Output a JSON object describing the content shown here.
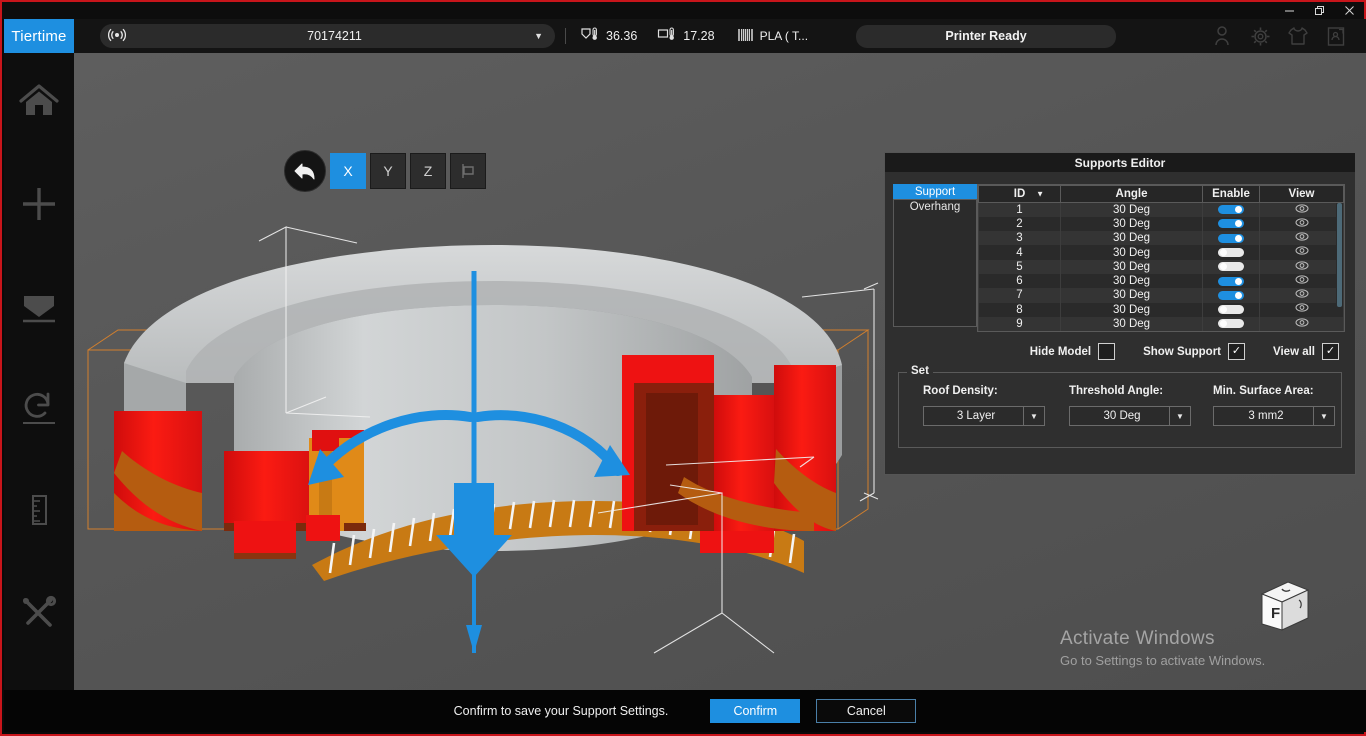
{
  "window": {
    "minimize_label": "minimize",
    "restore_label": "restore",
    "close_label": "close"
  },
  "toolbar": {
    "brand": "Tiertime",
    "printer_id": "70174211",
    "wifi_icon": "wifi-icon",
    "dropdown_icon": "chevron-down-icon",
    "nozzle_icon": "nozzle-temperature-icon",
    "nozzle_temp": "36.36",
    "bed_icon": "bed-temperature-icon",
    "bed_temp": "17.28",
    "material_icon": "material-spool-icon",
    "material": "PLA ( T...",
    "status": "Printer Ready",
    "right_icons": [
      {
        "name": "user-account-icon",
        "glyph": "user"
      },
      {
        "name": "settings-gear-icon",
        "glyph": "gear"
      },
      {
        "name": "theme-shirt-icon",
        "glyph": "shirt"
      },
      {
        "name": "export-print-icon",
        "glyph": "export"
      }
    ]
  },
  "sidebar": {
    "items": [
      {
        "name": "sidebar-item-home",
        "icon": "home-icon",
        "label": "Home"
      },
      {
        "name": "sidebar-item-add",
        "icon": "plus-icon",
        "label": "Add"
      },
      {
        "name": "sidebar-item-placement",
        "icon": "placement-icon",
        "label": "Placement"
      },
      {
        "name": "sidebar-item-rotate",
        "icon": "rotate-icon",
        "label": "Rotate"
      },
      {
        "name": "sidebar-item-scale",
        "icon": "ruler-icon",
        "label": "Scale"
      },
      {
        "name": "sidebar-item-tools",
        "icon": "tools-icon",
        "label": "Tools"
      }
    ]
  },
  "viewport": {
    "axis_toolbar": {
      "undo_icon": "undo-arrow-icon",
      "buttons": [
        {
          "label": "X",
          "active": true,
          "name": "axis-x-button"
        },
        {
          "label": "Y",
          "active": false,
          "name": "axis-y-button"
        },
        {
          "label": "Z",
          "active": false,
          "name": "axis-z-button"
        },
        {
          "label": "",
          "active": false,
          "name": "axis-mirror-button"
        }
      ]
    },
    "view_cube_face": "F",
    "watermark_title": "Activate Windows",
    "watermark_subtitle": "Go to Settings to activate Windows."
  },
  "panel": {
    "title": "Supports Editor",
    "tabs": [
      {
        "label": "Support",
        "active": true
      },
      {
        "label": "Overhang",
        "active": false
      }
    ],
    "table": {
      "columns": [
        "ID",
        "Angle",
        "Enable",
        "View"
      ],
      "sort_icon": "sort-descending-icon",
      "eye_icon": "eye-icon",
      "rows": [
        {
          "id": "1",
          "angle": "30 Deg",
          "enabled": true
        },
        {
          "id": "2",
          "angle": "30 Deg",
          "enabled": true
        },
        {
          "id": "3",
          "angle": "30 Deg",
          "enabled": true
        },
        {
          "id": "4",
          "angle": "30 Deg",
          "enabled": false
        },
        {
          "id": "5",
          "angle": "30 Deg",
          "enabled": false
        },
        {
          "id": "6",
          "angle": "30 Deg",
          "enabled": true
        },
        {
          "id": "7",
          "angle": "30 Deg",
          "enabled": true
        },
        {
          "id": "8",
          "angle": "30 Deg",
          "enabled": false
        },
        {
          "id": "9",
          "angle": "30 Deg",
          "enabled": false
        }
      ]
    },
    "checkboxes": [
      {
        "label": "Hide Model",
        "checked": false,
        "name": "hide-model-checkbox"
      },
      {
        "label": "Show Support",
        "checked": true,
        "name": "show-support-checkbox"
      },
      {
        "label": "View all",
        "checked": true,
        "name": "view-all-checkbox"
      }
    ],
    "set": {
      "legend": "Set",
      "fields": [
        {
          "label": "Roof Density:",
          "value": "3 Layer",
          "name": "roof-density-select"
        },
        {
          "label": "Threshold Angle:",
          "value": "30 Deg",
          "name": "threshold-angle-select"
        },
        {
          "label": "Min. Surface Area:",
          "value": "3 mm2",
          "name": "min-surface-area-select"
        }
      ]
    }
  },
  "footer": {
    "message": "Confirm to save your Support Settings.",
    "confirm_label": "Confirm",
    "cancel_label": "Cancel"
  },
  "colors": {
    "accent": "#1e8fe0",
    "frame": "#c8151b",
    "viewport_bg": "#565656",
    "support_red": "#ee1111",
    "support_orange": "#e08a18",
    "model_grey": "#c9cbcc"
  }
}
